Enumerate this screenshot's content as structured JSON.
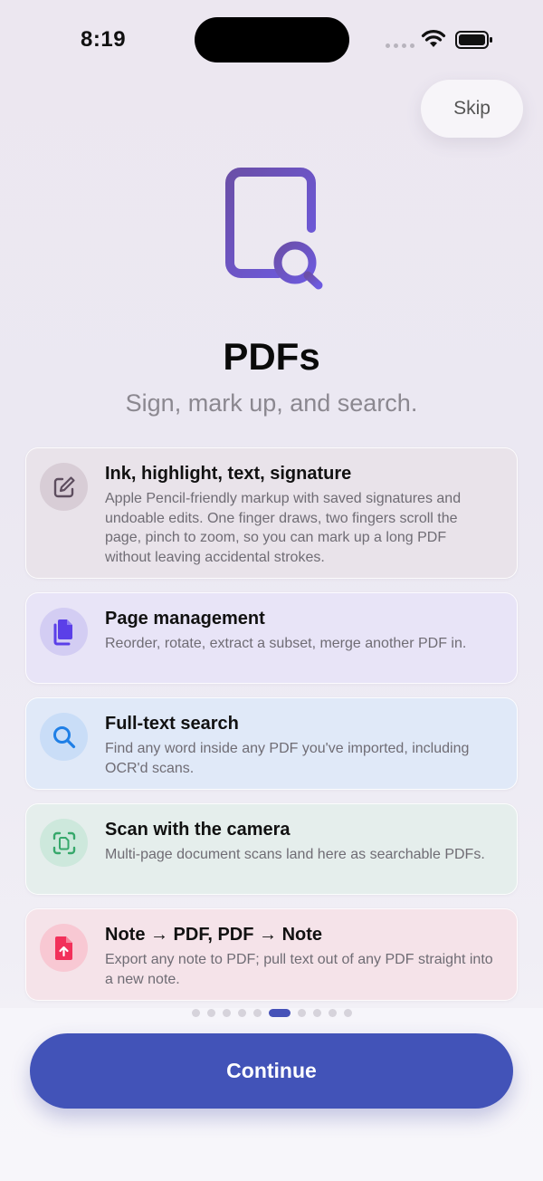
{
  "status_bar": {
    "time": "8:19"
  },
  "skip_label": "Skip",
  "title": "PDFs",
  "subtitle": "Sign, mark up, and search.",
  "features": [
    {
      "title": "Ink, highlight, text, signature",
      "description": "Apple Pencil-friendly markup with saved signatures and undoable edits. One finger draws, two fingers scroll the page, pinch to zoom, so you can mark up a long PDF without leaving accidental strokes.",
      "icon": "pencil-square-icon",
      "color": "#5d4d5e"
    },
    {
      "title": "Page management",
      "description": "Reorder, rotate, extract a subset, merge another PDF in.",
      "icon": "documents-icon",
      "color": "#5b3fe8"
    },
    {
      "title": "Full-text search",
      "description": "Find any word inside any PDF you've imported, including OCR'd scans.",
      "icon": "magnifier-icon",
      "color": "#1f7fe6"
    },
    {
      "title": "Scan with the camera",
      "description": "Multi-page document scans land here as searchable PDFs.",
      "icon": "document-scan-icon",
      "color": "#36a86b"
    },
    {
      "title": "Note → PDF, PDF → Note",
      "description": "Export any note to PDF; pull text out of any PDF straight into a new note.",
      "icon": "pdf-arrow-icon",
      "color": "#f2305a"
    }
  ],
  "pager": {
    "total": 10,
    "current": 6
  },
  "continue_label": "Continue",
  "colors": {
    "accent": "#4253b8",
    "hero_gradient_top": "#6b4fa8",
    "hero_gradient_bottom": "#6d5ae0"
  }
}
